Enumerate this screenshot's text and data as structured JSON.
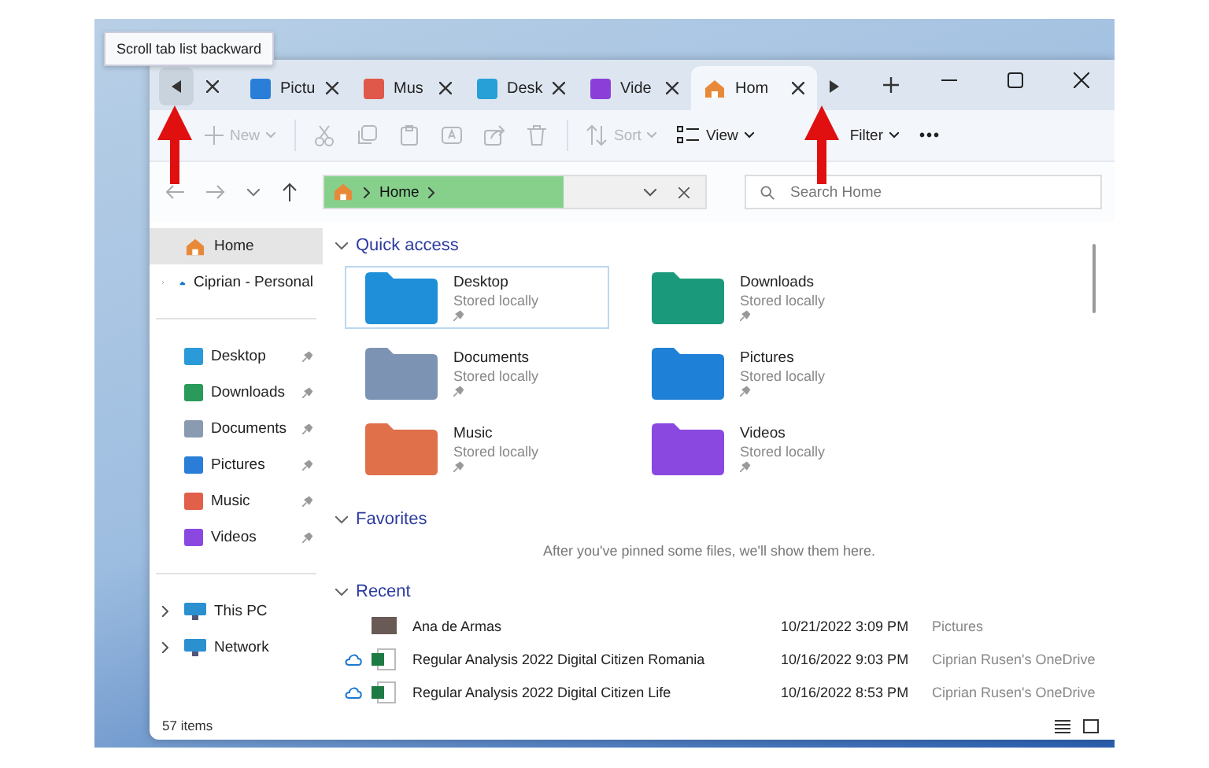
{
  "tooltip": "Scroll tab list backward",
  "tabs": [
    {
      "label": "Pictu",
      "selected": false
    },
    {
      "label": "Mus",
      "selected": false
    },
    {
      "label": "Desk",
      "selected": false
    },
    {
      "label": "Vide",
      "selected": false
    },
    {
      "label": "Hom",
      "selected": true
    }
  ],
  "toolbar": [
    {
      "kind": "new",
      "label": "New",
      "disabled": true
    },
    {
      "kind": "cut",
      "disabled": true
    },
    {
      "kind": "copy",
      "disabled": true
    },
    {
      "kind": "paste",
      "disabled": true
    },
    {
      "kind": "rename",
      "disabled": true
    },
    {
      "kind": "share",
      "disabled": true
    },
    {
      "kind": "delete",
      "disabled": true
    },
    {
      "kind": "sort",
      "label": "Sort",
      "disabled": true
    },
    {
      "kind": "view",
      "label": "View",
      "disabled": false
    },
    {
      "kind": "filter",
      "label": "Filter",
      "disabled": false
    },
    {
      "kind": "more",
      "label": "•••",
      "disabled": false
    }
  ],
  "address": {
    "path": "Home",
    "selected": true
  },
  "search": {
    "placeholder": "Search Home"
  },
  "sidebar": {
    "sections": [
      {
        "items": [
          {
            "label": "Home",
            "selected": true,
            "expandable": false,
            "pinned": false
          },
          {
            "label": "Ciprian - Personal",
            "selected": false,
            "expandable": true,
            "pinned": false
          }
        ]
      },
      {
        "items": [
          {
            "label": "Desktop",
            "selected": false,
            "expandable": false,
            "pinned": true
          },
          {
            "label": "Downloads",
            "selected": false,
            "expandable": false,
            "pinned": true
          },
          {
            "label": "Documents",
            "selected": false,
            "expandable": false,
            "pinned": true
          },
          {
            "label": "Pictures",
            "selected": false,
            "expandable": false,
            "pinned": true
          },
          {
            "label": "Music",
            "selected": false,
            "expandable": false,
            "pinned": true
          },
          {
            "label": "Videos",
            "selected": false,
            "expandable": false,
            "pinned": true
          }
        ]
      },
      {
        "items": [
          {
            "label": "This PC",
            "selected": false,
            "expandable": true,
            "pinned": false
          },
          {
            "label": "Network",
            "selected": false,
            "expandable": true,
            "pinned": false
          }
        ]
      }
    ]
  },
  "quick_access": {
    "title": "Quick access",
    "items": [
      {
        "name": "Desktop",
        "status": "Stored locally",
        "selected": true
      },
      {
        "name": "Downloads",
        "status": "Stored locally",
        "selected": false
      },
      {
        "name": "Documents",
        "status": "Stored locally",
        "selected": false
      },
      {
        "name": "Pictures",
        "status": "Stored locally",
        "selected": false
      },
      {
        "name": "Music",
        "status": "Stored locally",
        "selected": false
      },
      {
        "name": "Videos",
        "status": "Stored locally",
        "selected": false
      }
    ]
  },
  "favorites": {
    "title": "Favorites",
    "message": "After you've pinned some files, we'll show them here."
  },
  "recent": {
    "title": "Recent",
    "rows": [
      {
        "kind": "photo",
        "cloud": false,
        "name": "Ana de Armas",
        "date": "10/21/2022 3:09 PM",
        "location": "Pictures"
      },
      {
        "kind": "sheet",
        "cloud": true,
        "name": "Regular Analysis 2022 Digital Citizen Romania",
        "date": "10/16/2022 9:03 PM",
        "location": "Ciprian Rusen's OneDrive"
      },
      {
        "kind": "sheet",
        "cloud": true,
        "name": "Regular Analysis 2022 Digital Citizen Life",
        "date": "10/16/2022 8:53 PM",
        "location": "Ciprian Rusen's OneDrive"
      }
    ]
  },
  "status_bar": {
    "count": "57 items"
  }
}
